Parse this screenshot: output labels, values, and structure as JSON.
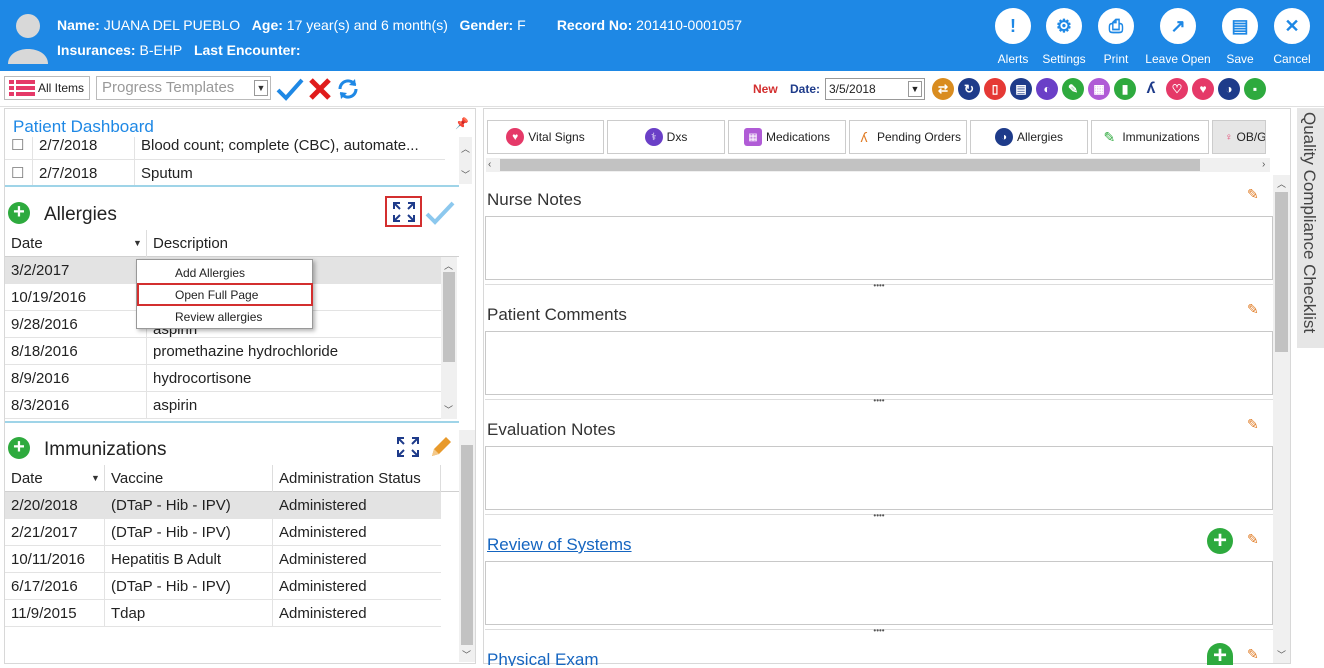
{
  "header": {
    "name_label": "Name:",
    "name_value": "JUANA DEL PUEBLO",
    "age_label": "Age:",
    "age_value": "17 year(s) and 6 month(s)",
    "gender_label": "Gender:",
    "gender_value": "F",
    "record_label": "Record No:",
    "record_value": "201410-0001057",
    "insurances_label": "Insurances:",
    "insurances_value": "B-EHP",
    "last_encounter_label": "Last Encounter:",
    "buttons": [
      {
        "label": "Alerts",
        "glyph": "!"
      },
      {
        "label": "Settings",
        "glyph": "⚙"
      },
      {
        "label": "Print",
        "glyph": "⎙"
      },
      {
        "label": "Leave Open",
        "glyph": "↗"
      },
      {
        "label": "Save",
        "glyph": "▤"
      },
      {
        "label": "Cancel",
        "glyph": "✕"
      }
    ]
  },
  "toolbar": {
    "all_items": "All Items",
    "template_placeholder": "Progress Templates",
    "new_label": "New",
    "date_label": "Date:",
    "date_value": "3/5/2018"
  },
  "left": {
    "dashboard_title": "Patient Dashboard",
    "orders": [
      {
        "date": "2/7/2018",
        "desc": "Blood count; complete (CBC), automate..."
      },
      {
        "date": "2/7/2018",
        "desc": "Sputum"
      }
    ],
    "allergies": {
      "title": "Allergies",
      "col_date": "Date",
      "col_desc": "Description",
      "rows": [
        {
          "date": "3/2/2017",
          "desc": ""
        },
        {
          "date": "10/19/2016",
          "desc": ""
        },
        {
          "date": "9/28/2016",
          "desc": "aspirin"
        },
        {
          "date": "8/18/2016",
          "desc": "promethazine hydrochloride"
        },
        {
          "date": "8/9/2016",
          "desc": "hydrocortisone"
        },
        {
          "date": "8/3/2016",
          "desc": "aspirin"
        }
      ]
    },
    "context_menu": [
      "Add Allergies",
      "Open Full Page",
      "Review allergies"
    ],
    "immunizations": {
      "title": "Immunizations",
      "col_date": "Date",
      "col_vaccine": "Vaccine",
      "col_status": "Administration Status",
      "rows": [
        {
          "date": "2/20/2018",
          "vaccine": "(DTaP - Hib - IPV)",
          "status": "Administered"
        },
        {
          "date": "2/21/2017",
          "vaccine": "(DTaP - Hib - IPV)",
          "status": "Administered"
        },
        {
          "date": "10/11/2016",
          "vaccine": "Hepatitis B Adult",
          "status": "Administered"
        },
        {
          "date": "6/17/2016",
          "vaccine": "(DTaP - Hib - IPV)",
          "status": "Administered"
        },
        {
          "date": "11/9/2015",
          "vaccine": "Tdap",
          "status": "Administered"
        }
      ]
    }
  },
  "right": {
    "tabs": [
      {
        "label": "Vital Signs",
        "color": "#e53968"
      },
      {
        "label": "Dxs",
        "color": "#6a3fc7"
      },
      {
        "label": "Medications",
        "color": "#b05bd6"
      },
      {
        "label": "Pending Orders",
        "color": "#e07b24"
      },
      {
        "label": "Allergies",
        "color": "#1e3b8a"
      },
      {
        "label": "Immunizations",
        "color": "#2eaa3e"
      },
      {
        "label": "OB/G",
        "color": "#e53968"
      }
    ],
    "notes": [
      "Nurse Notes",
      "Patient Comments",
      "Evaluation Notes",
      "Review of Systems",
      "Physical Exam"
    ],
    "side_panel": "Quality Compliance Checklist"
  }
}
